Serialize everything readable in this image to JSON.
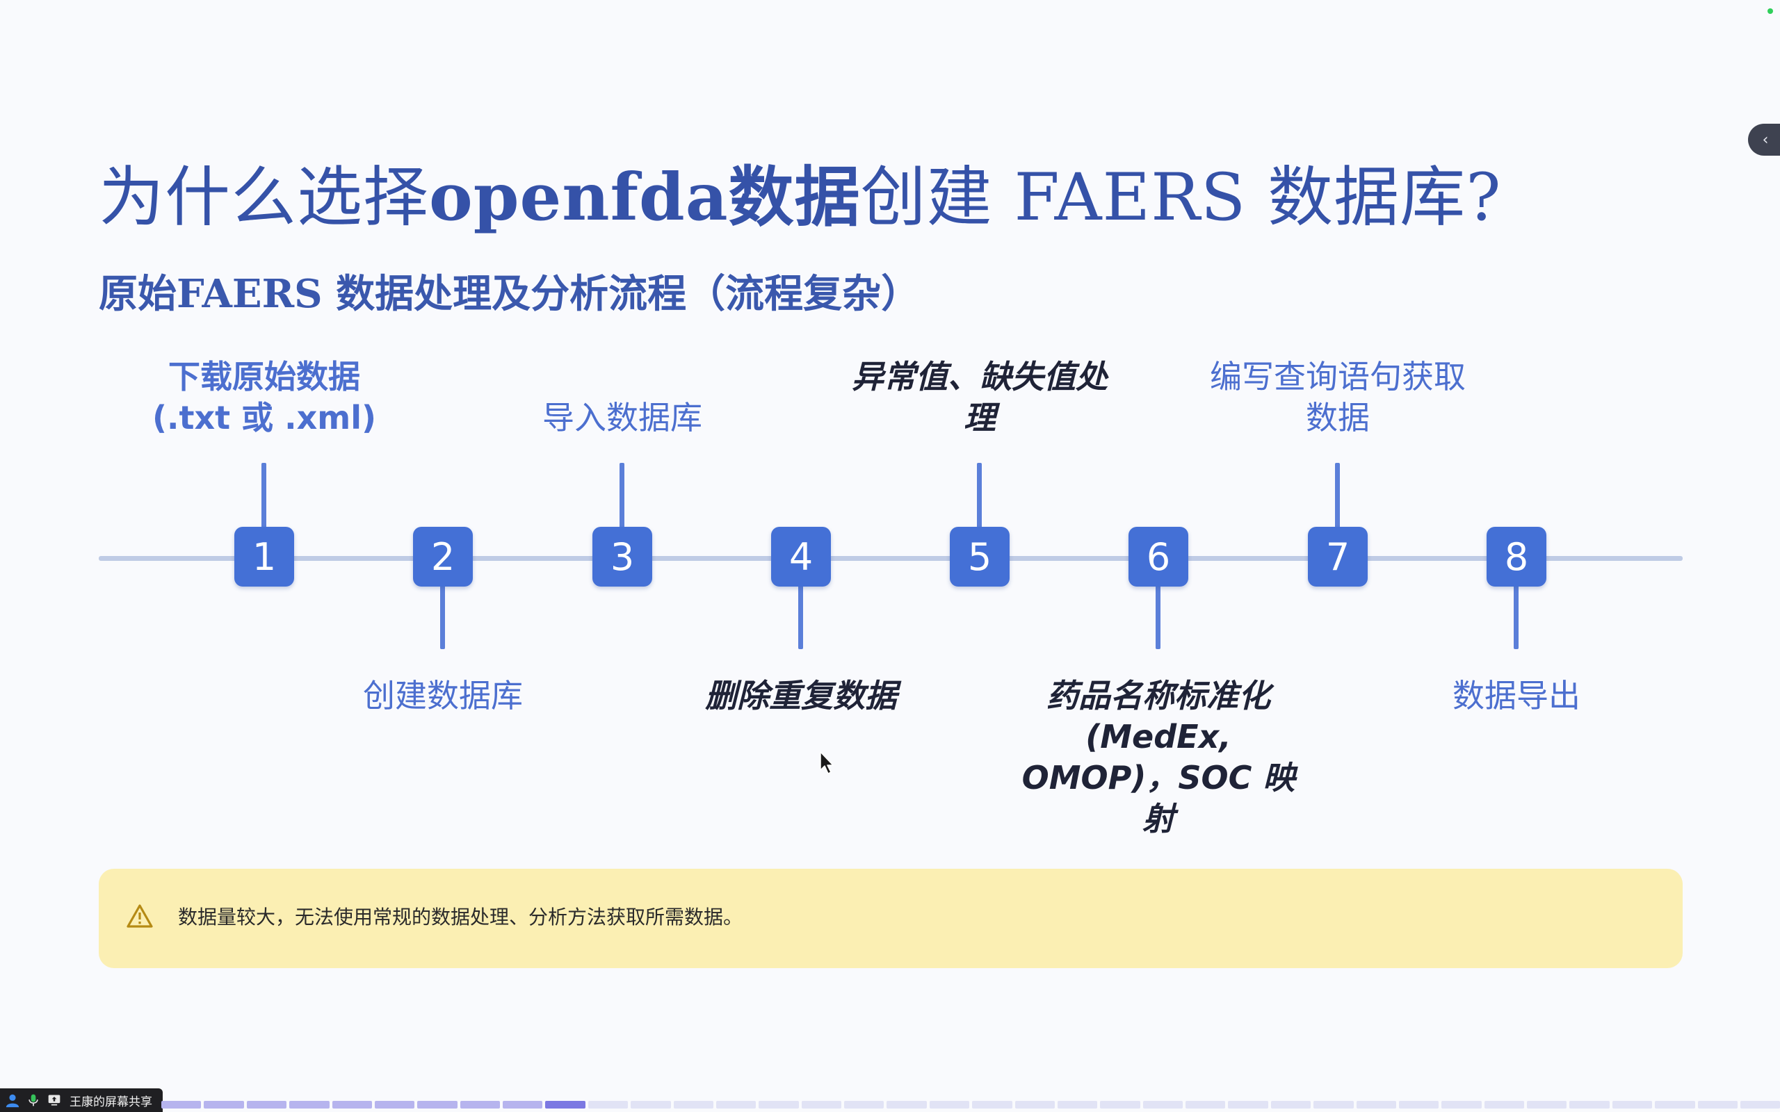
{
  "slide": {
    "title_prefix": "为什么选择",
    "title_bold": "openfda数据",
    "title_suffix": "创建 FAERS 数据库?",
    "subtitle_prefix": "原始FAERS 数据处理及分析流程（",
    "subtitle_bold": "流程复杂",
    "subtitle_suffix": "）",
    "steps": [
      {
        "number": "1",
        "label": "下载原始数据\n(.txt 或 .xml)"
      },
      {
        "number": "2",
        "label": "创建数据库"
      },
      {
        "number": "3",
        "label": "导入数据库"
      },
      {
        "number": "4",
        "label": "删除重复数据"
      },
      {
        "number": "5",
        "label": "异常值、缺失值处\n理"
      },
      {
        "number": "6",
        "label": "药品名称标准化\n(MedEx,\nOMOP)，SOC 映\n射"
      },
      {
        "number": "7",
        "label": "编写查询语句获取\n数据"
      },
      {
        "number": "8",
        "label": "数据导出"
      }
    ],
    "notice": {
      "icon": "warning-icon",
      "text": "数据量较大，无法使用常规的数据处理、分析方法获取所需数据。"
    }
  },
  "sidebar_toggle": {
    "icon": "chevron-left-icon",
    "glyph": "‹"
  },
  "share_bar": {
    "label": "王康的屏幕共享",
    "icons": [
      "user-icon",
      "microphone-icon",
      "screen-share-icon"
    ]
  },
  "progress": {
    "total_pages": 38,
    "current_page": 10
  },
  "colors": {
    "title": "#3552a8",
    "node": "#4470d6",
    "timeline": "#bfcbe5",
    "notice_bg": "#fbefb3"
  }
}
